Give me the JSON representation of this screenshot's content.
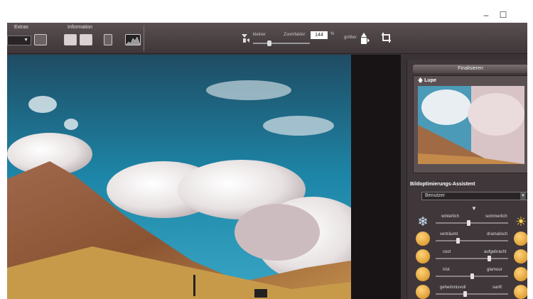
{
  "window": {
    "minimize_glyph": "–",
    "maximize_glyph": "☐"
  },
  "menu": {
    "extras": "Extras",
    "information": "Information"
  },
  "toolbar": {
    "select_value": "",
    "zoom": {
      "smaller_label": "kleiner",
      "factor_label": "Zoomfaktor",
      "factor_value": "144",
      "percent_sign": "%",
      "larger_label": "größer"
    }
  },
  "panel": {
    "finalize_button": "Finalisieren",
    "lupe_title": "Lupe",
    "assistant_title": "Bildoptimierungs-Assistent",
    "preset_value": "Benutzer",
    "rows": [
      {
        "left": "winterlich",
        "right": "sommerlich",
        "value": 0.45,
        "left_icon": "snowflake-icon",
        "right_icon": "sun-icon"
      },
      {
        "left": "verträumt",
        "right": "dramatisch",
        "value": 0.3
      },
      {
        "left": "cool",
        "right": "aufgebracht",
        "value": 0.75
      },
      {
        "left": "trist",
        "right": "glamour",
        "value": 0.5
      },
      {
        "left": "geheimnisvoll",
        "right": "sanft",
        "value": 0.4
      }
    ]
  }
}
